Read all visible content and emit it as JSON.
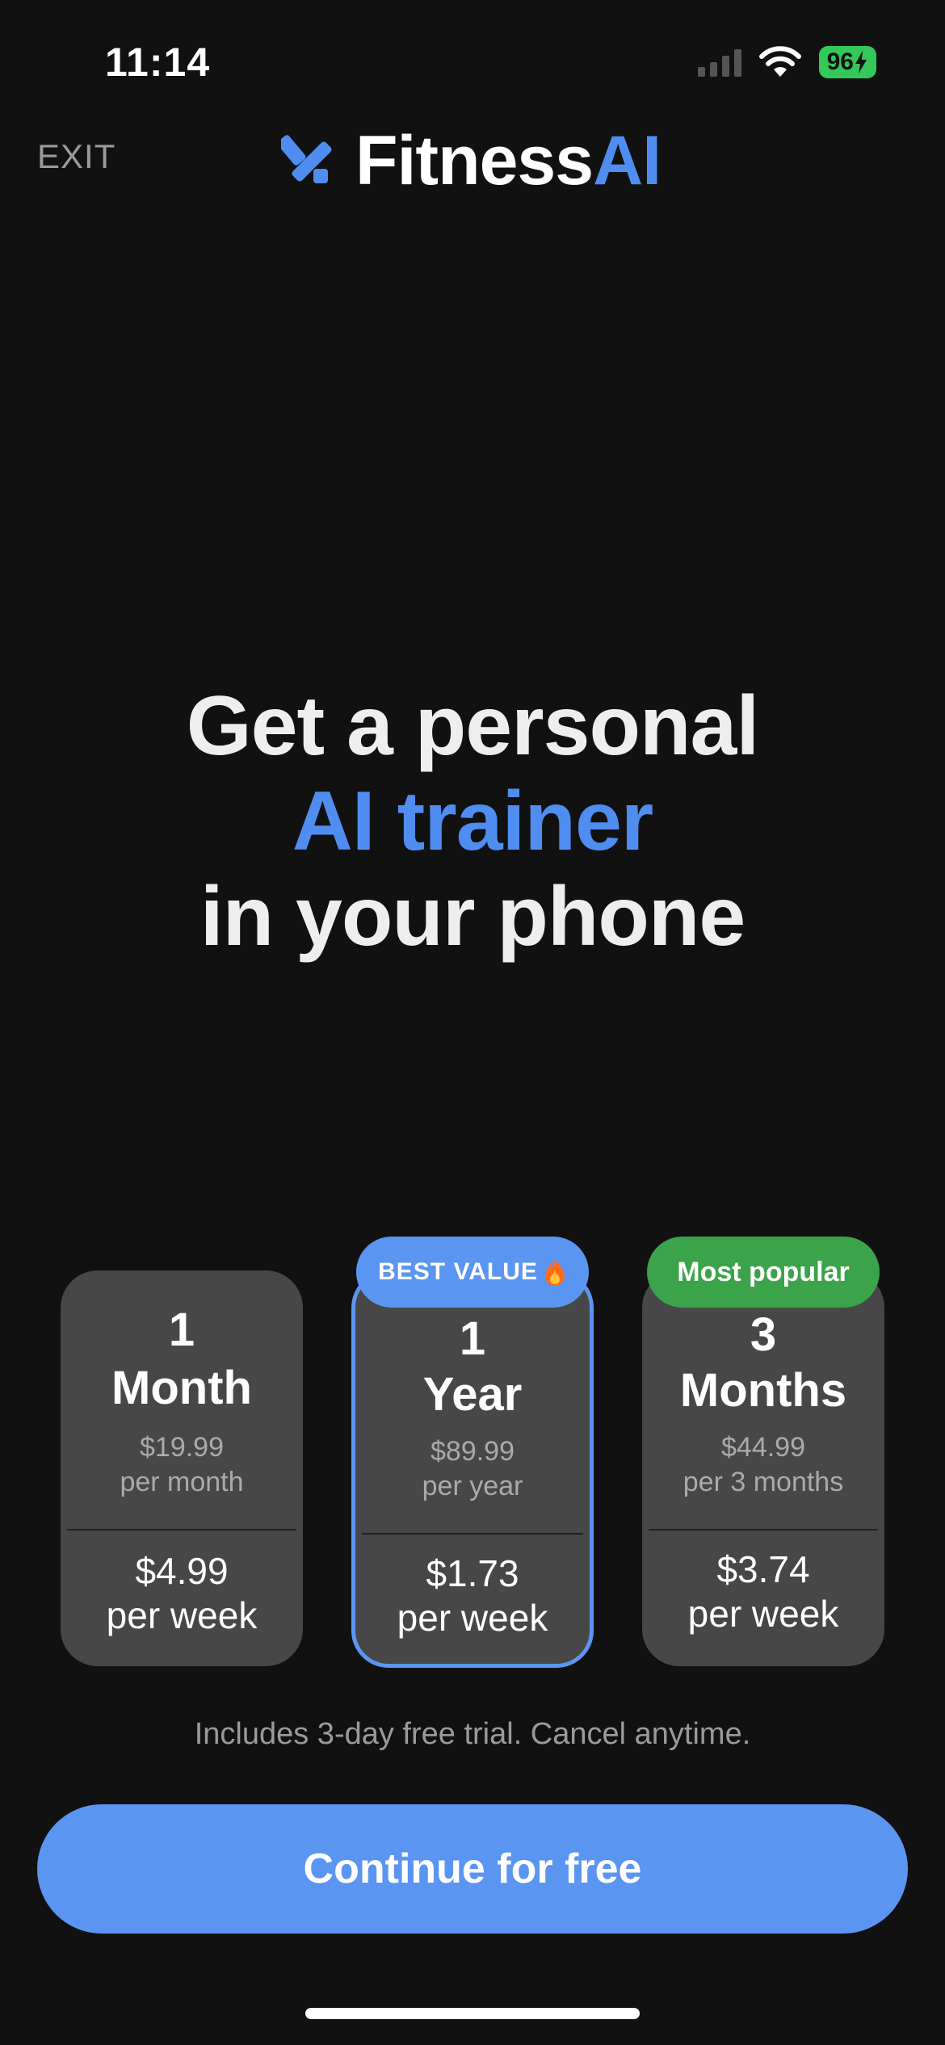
{
  "status_bar": {
    "time": "11:14",
    "battery": "96",
    "icons": [
      "signal-icon",
      "wifi-icon",
      "charging-bolt-icon"
    ]
  },
  "header": {
    "exit_label": "EXIT",
    "brand_prefix": "Fitness",
    "brand_suffix": "AI",
    "logo_icon": "fitnessai-logo-icon"
  },
  "headline": {
    "line1": "Get a personal",
    "line2": "AI trainer",
    "line3": "in your phone"
  },
  "plans": [
    {
      "number": "1",
      "unit": "Month",
      "price": "$19.99",
      "period": "per month",
      "weekly_price": "$4.99",
      "weekly_label": "per week",
      "selected": false
    },
    {
      "number": "1",
      "unit": "Year",
      "price": "$89.99",
      "period": "per year",
      "weekly_price": "$1.73",
      "weekly_label": "per week",
      "selected": true,
      "badge": "BEST VALUE",
      "badge_icon": "fire-icon"
    },
    {
      "number": "3",
      "unit": "Months",
      "price": "$44.99",
      "period": "per 3 months",
      "weekly_price": "$3.74",
      "weekly_label": "per week",
      "selected": false,
      "badge": "Most popular"
    }
  ],
  "trial_note": "Includes 3-day free trial. Cancel anytime.",
  "cta_label": "Continue for free",
  "colors": {
    "background": "#111111",
    "accent": "#5b95f2",
    "popular": "#3ba34a",
    "card": "#474747",
    "battery": "#34c759"
  }
}
